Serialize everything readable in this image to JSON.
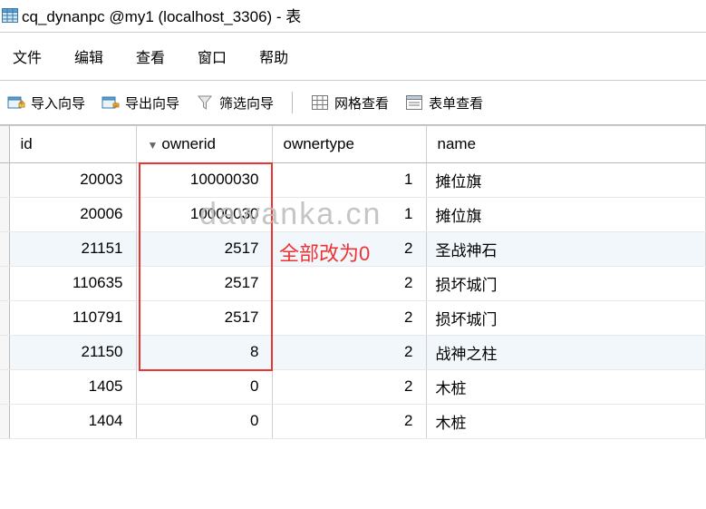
{
  "window": {
    "title": "cq_dynanpc @my1 (localhost_3306) - 表"
  },
  "menu": {
    "file": "文件",
    "edit": "编辑",
    "view": "查看",
    "window": "窗口",
    "help": "帮助"
  },
  "toolbar": {
    "import_wizard": "导入向导",
    "export_wizard": "导出向导",
    "filter_wizard": "筛选向导",
    "grid_view": "网格查看",
    "form_view": "表单查看"
  },
  "columns": {
    "id": "id",
    "ownerid": "ownerid",
    "ownertype": "ownertype",
    "name": "name"
  },
  "rows": [
    {
      "id": "20003",
      "ownerid": "10000030",
      "ownertype": "1",
      "name": "摊位旗"
    },
    {
      "id": "20006",
      "ownerid": "10000030",
      "ownertype": "1",
      "name": "摊位旗"
    },
    {
      "id": "21151",
      "ownerid": "2517",
      "ownertype": "2",
      "name": "圣战神石"
    },
    {
      "id": "110635",
      "ownerid": "2517",
      "ownertype": "2",
      "name": "损坏城门"
    },
    {
      "id": "110791",
      "ownerid": "2517",
      "ownertype": "2",
      "name": "损坏城门"
    },
    {
      "id": "21150",
      "ownerid": "8",
      "ownertype": "2",
      "name": "战神之柱"
    },
    {
      "id": "1405",
      "ownerid": "0",
      "ownertype": "2",
      "name": "木桩"
    },
    {
      "id": "1404",
      "ownerid": "0",
      "ownertype": "2",
      "name": "木桩"
    }
  ],
  "annotations": {
    "change_all_to_zero": "全部改为0",
    "watermark": "dawanka.cn"
  }
}
